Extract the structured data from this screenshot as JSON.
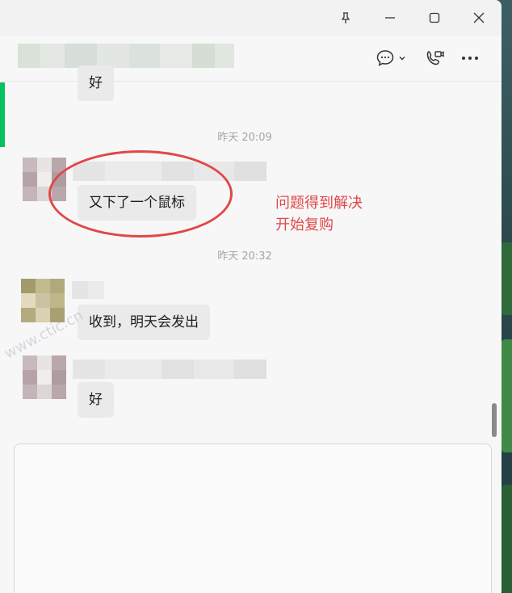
{
  "titlebar": {
    "pin_icon": "pin-icon",
    "minimize_icon": "minimize-icon",
    "maximize_icon": "maximize-icon",
    "close_icon": "close-icon"
  },
  "header": {
    "chat_icon": "chat-bubble-icon",
    "chevron_icon": "chevron-down-icon",
    "call_icon": "video-phone-icon",
    "more_icon": "more-icon"
  },
  "messages": {
    "partial_reply": "好",
    "time1": "昨天 20:09",
    "msg1": "又下了一个鼠标",
    "time2": "昨天 20:32",
    "msg2": "收到，明天会发出",
    "msg3": "好"
  },
  "annotation": {
    "line1": "问题得到解决",
    "line2": "开始复购",
    "color": "#e14848"
  },
  "watermark": "www.ctic.cn",
  "colors": {
    "accent": "#07c160",
    "bubble": "#eaeaea",
    "annotation": "#e14848"
  }
}
